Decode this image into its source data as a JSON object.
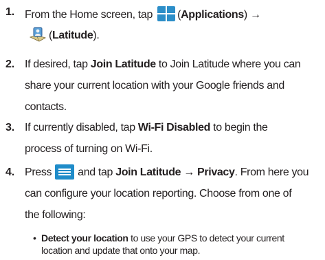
{
  "steps": [
    {
      "number": "1.",
      "parts": {
        "a": "From the Home screen, tap ",
        "b": "(",
        "c": "Applications",
        "d": ") →",
        "e": "(",
        "f": "Latitude",
        "g": ")."
      }
    },
    {
      "number": "2.",
      "parts": {
        "a": "If desired, tap ",
        "b": "Join Latitude",
        "c": " to Join Latitude where you can",
        "d": "share your current location with your Google friends and",
        "e": "contacts."
      }
    },
    {
      "number": "3.",
      "parts": {
        "a": "If currently disabled, tap ",
        "b": "Wi-Fi Disabled",
        "c": " to begin the",
        "d": "process of turning on Wi-Fi."
      }
    },
    {
      "number": "4.",
      "parts": {
        "a": "Press",
        "b": "and tap ",
        "c": "Join Latitude → Privacy",
        "d": ". From here you",
        "e": "can configure your location reporting. Choose from one of",
        "f": "the following:"
      }
    }
  ],
  "bullets": [
    {
      "dot": "•",
      "bold": "Detect your location",
      "text": " to use your GPS to detect your current",
      "text2": "location and update that onto your map."
    }
  ],
  "icons": {
    "applications": "applications-grid-icon",
    "latitude": "latitude-app-icon",
    "menu": "menu-key-icon",
    "applications_color": "#2c8ec8",
    "menu_color": "#1f8cc9"
  }
}
